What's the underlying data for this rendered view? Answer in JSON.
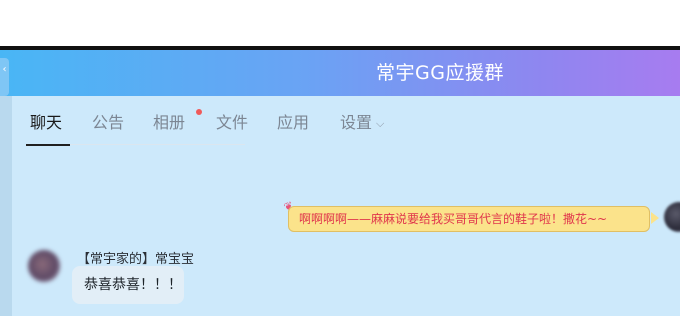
{
  "header": {
    "title": "常宇GG应援群"
  },
  "tabs": [
    {
      "label": "聊天",
      "active": true
    },
    {
      "label": "公告"
    },
    {
      "label": "相册",
      "has_badge_dot": true
    },
    {
      "label": "文件"
    },
    {
      "label": "应用"
    },
    {
      "label": "设置"
    }
  ],
  "messages": {
    "right": {
      "text": "啊啊啊啊——麻麻说要给我买哥哥代言的鞋子啦！撒花~~"
    },
    "left": {
      "sender": "【常宇家的】常宝宝",
      "text": "恭喜恭喜！！！"
    }
  },
  "colors": {
    "header_start": "#49b6f5",
    "header_end": "#a77cf0",
    "chat_bg": "#cde9fb",
    "highlight_bubble": "#fbe38b",
    "highlight_text": "#e0364c",
    "badge_dot": "#f05a5a"
  },
  "icons": {
    "settings_chevron": "chevron-down-icon",
    "back": "back-tab-icon"
  }
}
